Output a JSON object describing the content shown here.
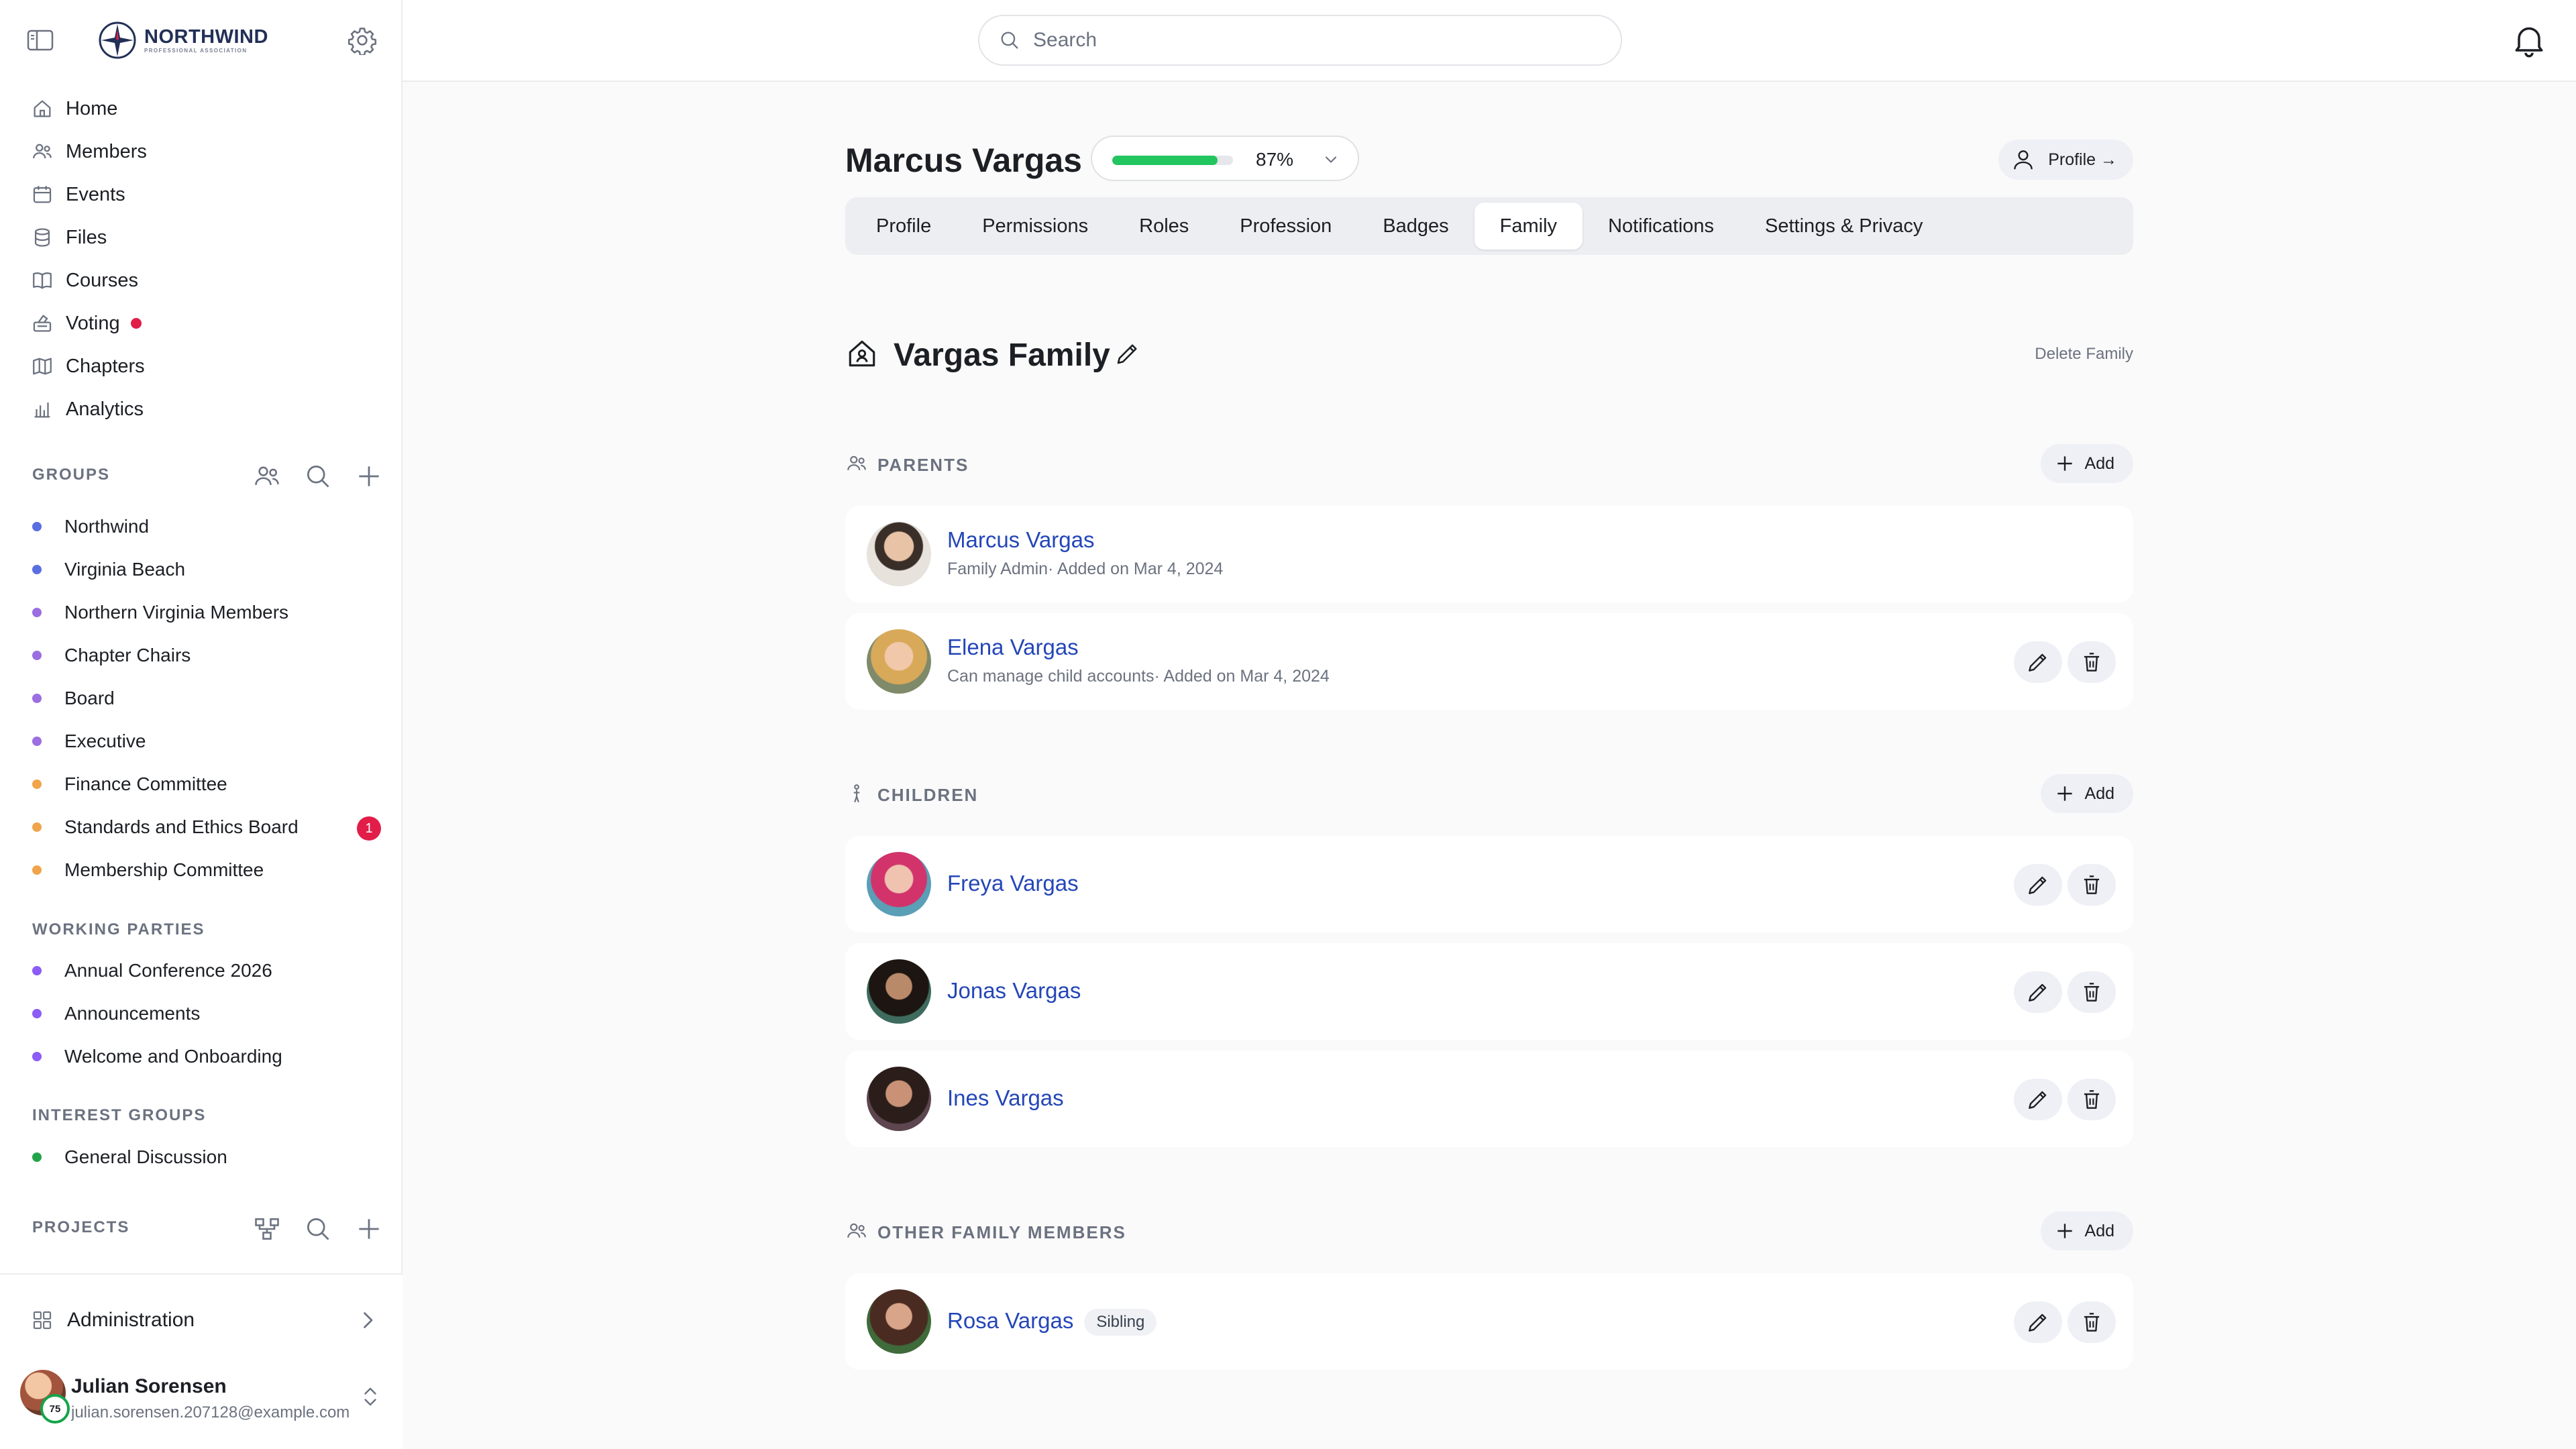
{
  "brand": {
    "name": "NORTHWIND",
    "tagline": "PROFESSIONAL ASSOCIATION"
  },
  "nav": [
    {
      "label": "Home",
      "icon": "home-icon"
    },
    {
      "label": "Members",
      "icon": "members-icon"
    },
    {
      "label": "Events",
      "icon": "calendar-icon"
    },
    {
      "label": "Files",
      "icon": "database-icon"
    },
    {
      "label": "Courses",
      "icon": "book-icon"
    },
    {
      "label": "Voting",
      "icon": "ballot-icon",
      "alert": true
    },
    {
      "label": "Chapters",
      "icon": "map-icon"
    },
    {
      "label": "Analytics",
      "icon": "analytics-icon"
    }
  ],
  "groups": {
    "heading": "GROUPS",
    "items": [
      {
        "label": "Northwind",
        "color": "#5b6ee1"
      },
      {
        "label": "Virginia Beach",
        "color": "#5b6ee1"
      },
      {
        "label": "Northern Virginia Members",
        "color": "#9b6ee1"
      },
      {
        "label": "Chapter Chairs",
        "color": "#9b6ee1"
      },
      {
        "label": "Board",
        "color": "#9b6ee1"
      },
      {
        "label": "Executive",
        "color": "#9b6ee1"
      },
      {
        "label": "Finance Committee",
        "color": "#f0a44b"
      },
      {
        "label": "Standards and Ethics Board",
        "color": "#f0a44b",
        "badge": "1"
      },
      {
        "label": "Membership Committee",
        "color": "#f0a44b"
      }
    ]
  },
  "working_parties": {
    "heading": "WORKING PARTIES",
    "items": [
      {
        "label": "Annual Conference 2026",
        "color": "#8b5cf6"
      },
      {
        "label": "Announcements",
        "color": "#8b5cf6"
      },
      {
        "label": "Welcome and Onboarding",
        "color": "#8b5cf6"
      }
    ]
  },
  "interest_groups": {
    "heading": "INTEREST GROUPS",
    "items": [
      {
        "label": "General Discussion",
        "color": "#22a34a"
      }
    ]
  },
  "projects": {
    "heading": "PROJECTS"
  },
  "sidebar_footer": {
    "admin_label": "Administration",
    "user_name": "Julian Sorensen",
    "user_email": "julian.sorensen.207128@example.com",
    "user_score": "75"
  },
  "search": {
    "placeholder": "Search"
  },
  "profile": {
    "name": "Marcus Vargas",
    "completion": 0.87,
    "completion_label": "87%",
    "profile_button": "Profile →"
  },
  "tabs": [
    {
      "label": "Profile",
      "active": false
    },
    {
      "label": "Permissions",
      "active": false
    },
    {
      "label": "Roles",
      "active": false
    },
    {
      "label": "Profession",
      "active": false
    },
    {
      "label": "Badges",
      "active": false
    },
    {
      "label": "Family",
      "active": true
    },
    {
      "label": "Notifications",
      "active": false
    },
    {
      "label": "Settings & Privacy",
      "active": false
    }
  ],
  "family": {
    "title": "Vargas Family",
    "delete_label": "Delete Family",
    "add_label": "Add",
    "parents": {
      "heading": "PARENTS",
      "members": [
        {
          "name": "Marcus Vargas",
          "detail": "Family Admin· Added on Mar 4, 2024",
          "admin": true
        },
        {
          "name": "Elena Vargas",
          "detail": "Can manage child accounts· Added on Mar 4, 2024"
        }
      ]
    },
    "children": {
      "heading": "CHILDREN",
      "members": [
        {
          "name": "Freya Vargas"
        },
        {
          "name": "Jonas Vargas"
        },
        {
          "name": "Ines Vargas"
        }
      ]
    },
    "other": {
      "heading": "OTHER FAMILY MEMBERS",
      "members": [
        {
          "name": "Rosa Vargas",
          "tag": "Sibling"
        }
      ]
    }
  }
}
